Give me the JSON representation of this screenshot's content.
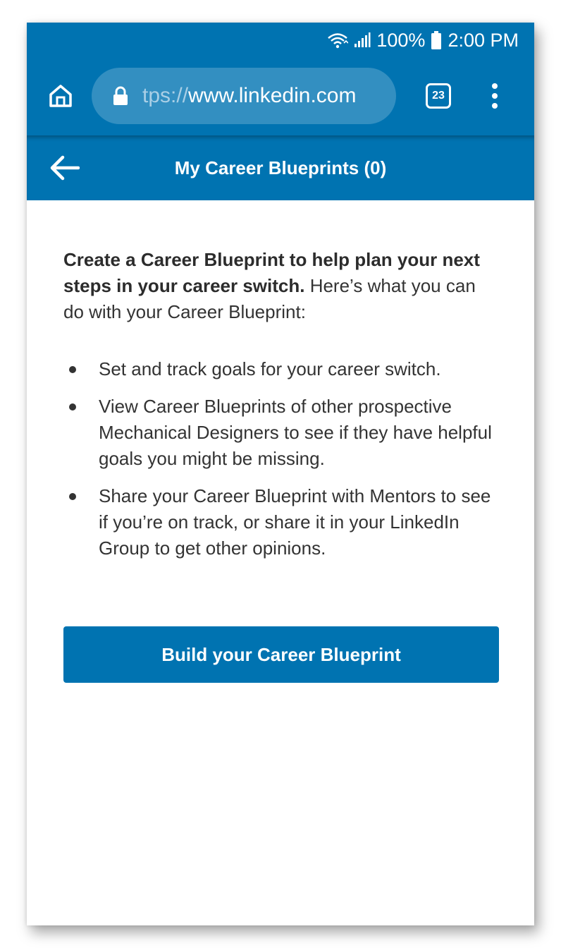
{
  "status_bar": {
    "battery_percent": "100%",
    "time": "2:00 PM",
    "icons": [
      "wifi-icon",
      "signal-icon",
      "battery-icon"
    ]
  },
  "browser": {
    "url_scheme": "tps://",
    "url_host": "www.linkedin.com",
    "tab_count": "23",
    "icons": [
      "home-icon",
      "lock-icon",
      "tabs-icon",
      "more-vert-icon"
    ]
  },
  "header": {
    "title": "My Career Blueprints (0)",
    "back_icon": "arrow-left-icon"
  },
  "content": {
    "intro_bold": "Create a Career Blueprint to help plan your next steps in your career switch.",
    "intro_rest": " Here’s what you can do with your Career Blueprint:",
    "bullets": [
      "Set and track goals for your career switch.",
      "View Career Blueprints of other prospective Mechanical Designers to see if they have helpful goals you might be missing.",
      "Share your Career Blueprint with Mentors to see if you’re on track, or share it in your LinkedIn Group to get other opinions."
    ]
  },
  "cta": {
    "label": "Build your Career Blueprint"
  },
  "colors": {
    "brand_blue": "#0073b1",
    "url_pill": "#338fc1",
    "text": "#333333"
  }
}
